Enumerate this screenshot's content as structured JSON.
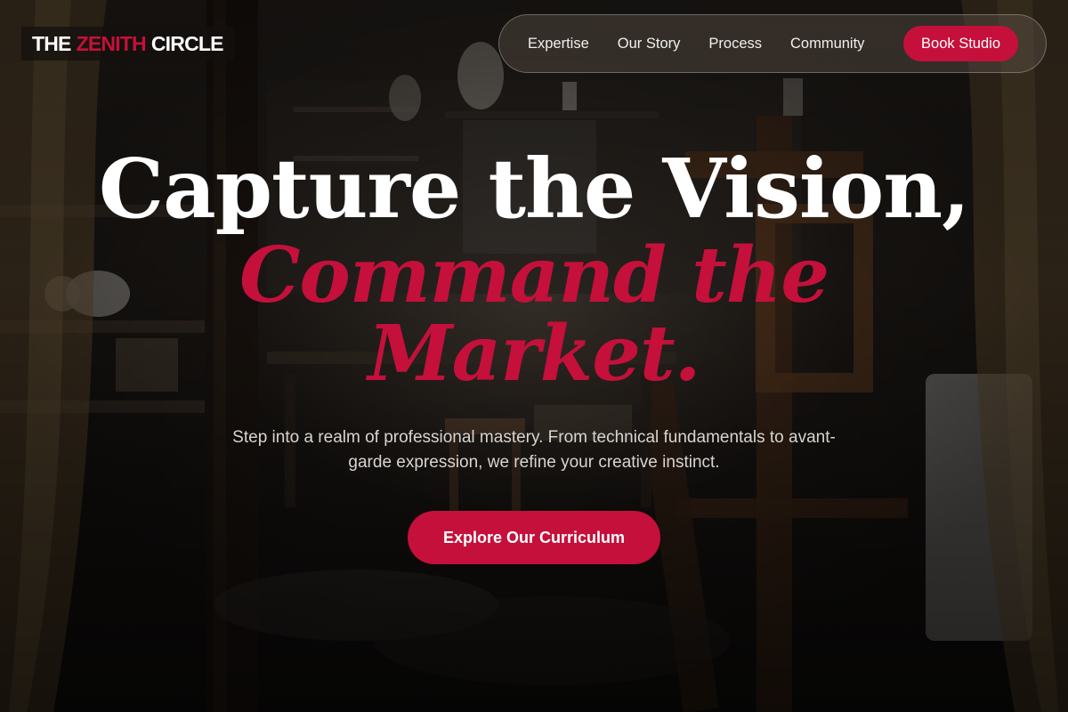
{
  "logo": {
    "part1": "THE",
    "part2": "ZENITH",
    "part3": "CIRCLE"
  },
  "nav": {
    "items": [
      "Expertise",
      "Our Story",
      "Process",
      "Community"
    ],
    "cta_label": "Book Studio"
  },
  "hero": {
    "headline_line1": "Capture the Vision,",
    "headline_line2": "Command the",
    "headline_line3": "Market.",
    "subtitle": "Step into a realm of professional mastery. From technical fundamentals to avant-garde expression, we refine your creative instinct.",
    "cta_label": "Explore Our Curriculum",
    "background": "photography-studio-interior"
  },
  "colors": {
    "accent": "#c4103a",
    "text": "#ffffff",
    "subtext": "#d8d4d0"
  }
}
